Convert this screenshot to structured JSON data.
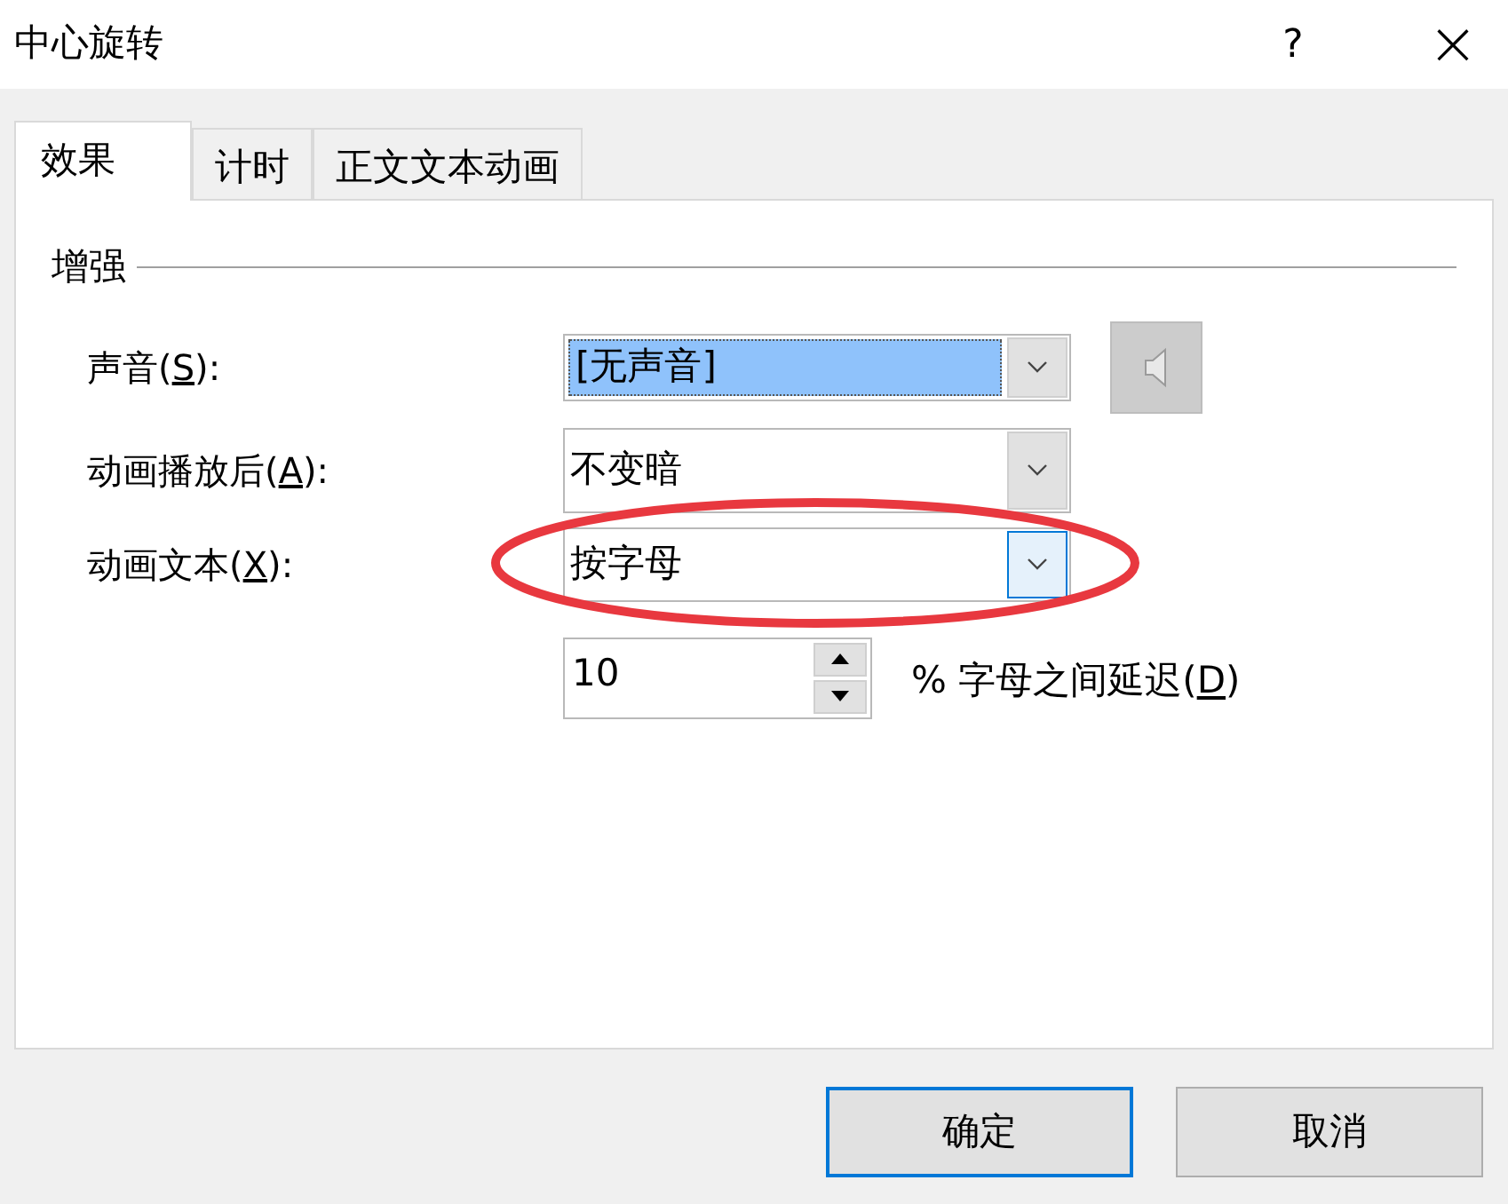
{
  "window": {
    "title": "中心旋转",
    "help": "?",
    "close": "×"
  },
  "tabs": [
    {
      "label": "效果",
      "selected": true
    },
    {
      "label": "计时",
      "selected": false
    },
    {
      "label": "正文文本动画",
      "selected": false
    }
  ],
  "group": {
    "title": "增强"
  },
  "rows": [
    {
      "label_before": "声音(",
      "access_key": "S",
      "label_after": "):",
      "value": "[无声音]",
      "highlighted": true,
      "arrow_hover": false,
      "speaker": true,
      "circled": false
    },
    {
      "label_before": "动画播放后(",
      "access_key": "A",
      "label_after": "):",
      "value": "不变暗",
      "highlighted": false,
      "arrow_hover": false,
      "speaker": false,
      "circled": false
    },
    {
      "label_before": "动画文本(",
      "access_key": "X",
      "label_after": "):",
      "value": "按字母",
      "highlighted": false,
      "arrow_hover": true,
      "speaker": false,
      "circled": true
    }
  ],
  "delay": {
    "value": "10",
    "label_before": "% 字母之间延迟(",
    "access_key": "D",
    "label_after": ")"
  },
  "buttons": [
    {
      "label": "确定",
      "default": true
    },
    {
      "label": "取消",
      "default": false
    }
  ]
}
